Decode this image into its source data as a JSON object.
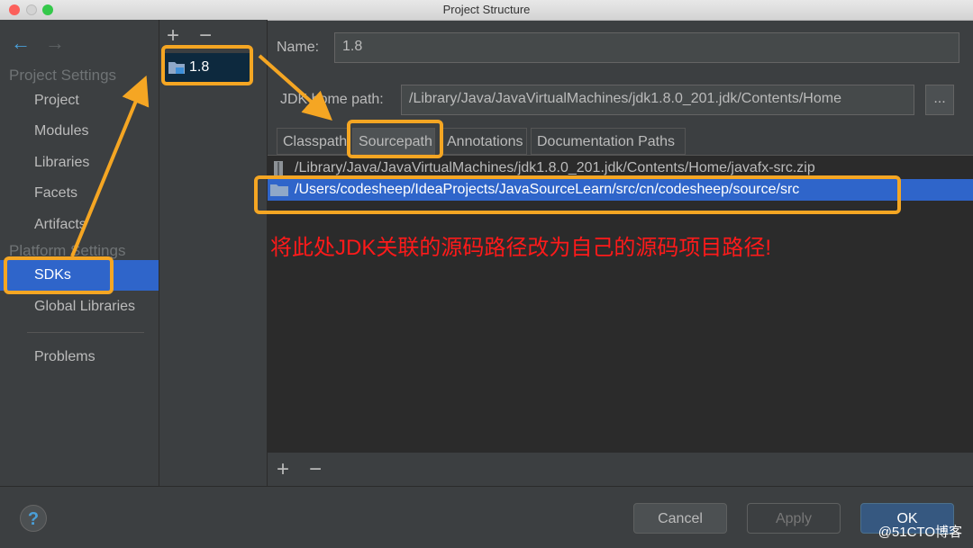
{
  "window": {
    "title": "Project Structure"
  },
  "nav": {
    "project_settings_header": "Project Settings",
    "platform_settings_header": "Platform Settings",
    "items": [
      "Project",
      "Modules",
      "Libraries",
      "Facets",
      "Artifacts"
    ],
    "platform_items": [
      "SDKs",
      "Global Libraries"
    ],
    "problems": "Problems"
  },
  "sdk_list": {
    "items": [
      "1.8"
    ],
    "add": "+",
    "remove": "−"
  },
  "main": {
    "name_label": "Name:",
    "name_value": "1.8",
    "jdk_home_label": "JDK home path:",
    "jdk_home_value": "/Library/Java/JavaVirtualMachines/jdk1.8.0_201.jdk/Contents/Home",
    "browse_label": "...",
    "tabs": [
      "Classpath",
      "Sourcepath",
      "Annotations",
      "Documentation Paths"
    ],
    "paths": [
      "/Library/Java/JavaVirtualMachines/jdk1.8.0_201.jdk/Contents/Home/javafx-src.zip",
      "/Users/codesheep/IdeaProjects/JavaSourceLearn/src/cn/codesheep/source/src"
    ],
    "add": "+",
    "remove": "−"
  },
  "bottom": {
    "help": "?",
    "cancel": "Cancel",
    "apply": "Apply",
    "ok": "OK"
  },
  "annotation": {
    "note": "将此处JDK关联的源码路径改为自己的源码项目路径!"
  },
  "watermark": "@51CTO博客",
  "colors": {
    "accent": "#f5a623",
    "selection": "#2f65ca",
    "note": "#ff1a1a"
  }
}
